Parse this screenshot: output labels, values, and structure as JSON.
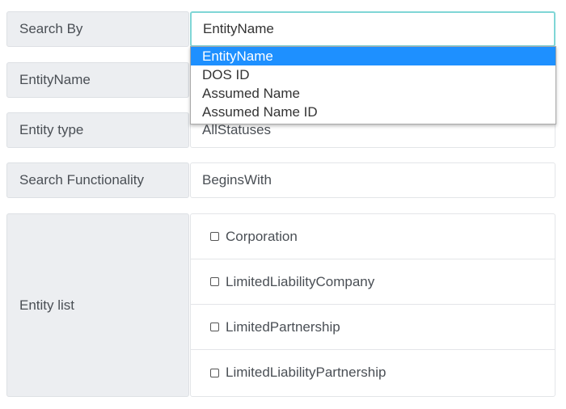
{
  "form": {
    "search_by": {
      "label": "Search By",
      "value": "EntityName",
      "options": [
        "EntityName",
        "DOS ID",
        "Assumed Name",
        "Assumed Name ID"
      ]
    },
    "entity_name": {
      "label": "EntityName",
      "value": ""
    },
    "entity_type": {
      "label": "Entity type",
      "value": "AllStatuses"
    },
    "search_functionality": {
      "label": "Search Functionality",
      "value": "BeginsWith"
    },
    "entity_list": {
      "label": "Entity list",
      "items": [
        "Corporation",
        "LimitedLiabilityCompany",
        "LimitedPartnership",
        "LimitedLiabilityPartnership"
      ]
    }
  },
  "colors": {
    "label_bg": "#eceef1",
    "focus_border": "#7fd6d6",
    "option_highlight": "#1e90ff"
  }
}
